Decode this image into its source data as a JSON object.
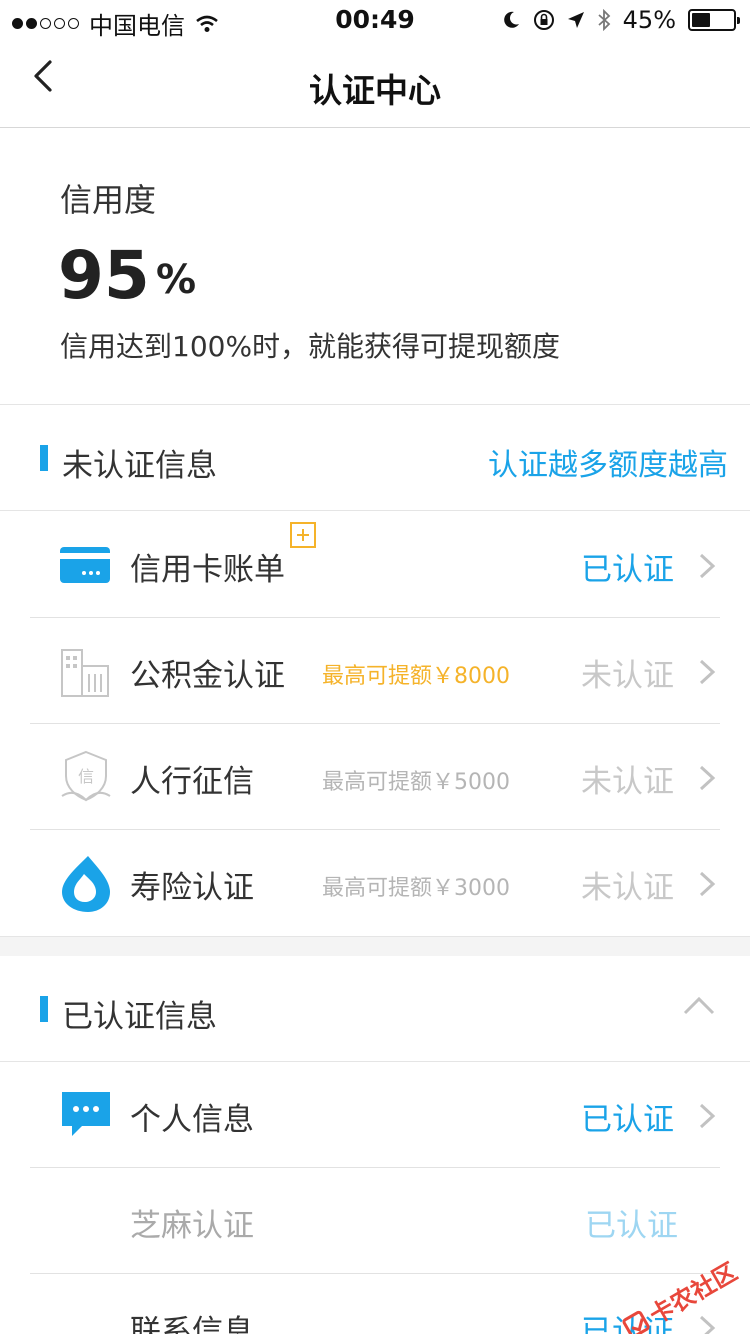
{
  "status_bar": {
    "carrier": "中国电信",
    "time": "00:49",
    "battery": "45%",
    "signal_bars_filled": 2,
    "signal_bars_total": 5,
    "battery_level": 0.45
  },
  "nav": {
    "title": "认证中心",
    "back_icon": "chevron-left-icon"
  },
  "credit": {
    "label": "信用度",
    "value": "95",
    "unit": "%",
    "description": "信用达到100%时，就能获得可提现额度"
  },
  "unverified": {
    "title": "未认证信息",
    "hint": "认证越多额度越高",
    "items": [
      {
        "label": "信用卡账单",
        "limit": "",
        "status": "已认证",
        "icon": "credit-card-icon"
      },
      {
        "label": "公积金认证",
        "limit": "最高可提额￥8000",
        "status": "未认证",
        "icon": "building-icon"
      },
      {
        "label": "人行征信",
        "limit": "最高可提额￥5000",
        "status": "未认证",
        "icon": "shield-icon"
      },
      {
        "label": "寿险认证",
        "limit": "最高可提额￥3000",
        "status": "未认证",
        "icon": "water-drop-icon"
      }
    ]
  },
  "verified": {
    "title": "已认证信息",
    "items": [
      {
        "label": "个人信息",
        "status": "已认证",
        "icon": "chat-bubble-icon"
      },
      {
        "label": "芝麻认证",
        "status": "已认证"
      },
      {
        "label": "联系信息",
        "status": "已认证"
      }
    ]
  },
  "watermark": "卡农社区",
  "colors": {
    "accent": "#1aa3e8",
    "orange": "#f5b32a",
    "muted": "#c8c8c8"
  }
}
